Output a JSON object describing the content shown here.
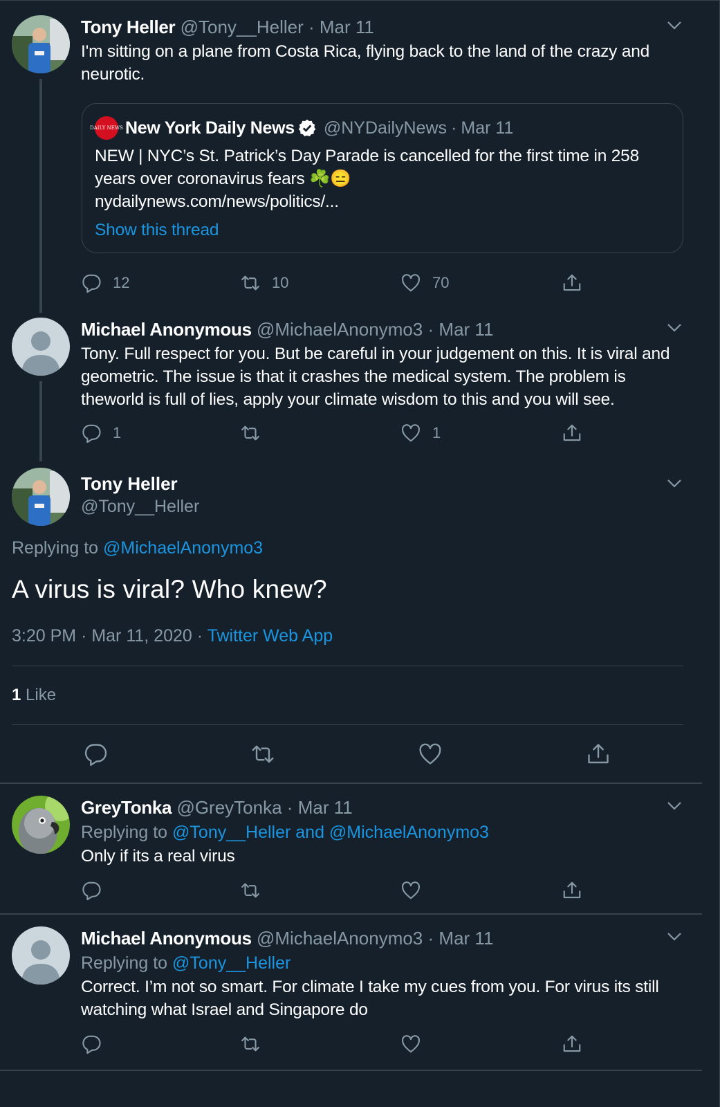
{
  "tweets": [
    {
      "name": "Tony Heller",
      "handle": "@Tony__Heller",
      "dot": "·",
      "date": "Mar 11",
      "text": "I'm sitting on a plane from Costa Rica, flying back to the land of the crazy and neurotic.",
      "quote": {
        "logo_text": "DAILY NEWS",
        "name": "New York Daily News",
        "handle": "@NYDailyNews",
        "dot": "·",
        "date": "Mar 11",
        "text": "NEW | NYC’s St. Patrick’s Day Parade is cancelled for the first time in 258 years over coronavirus fears ☘️😑",
        "url": "nydailynews.com/news/politics/...",
        "thread_link": "Show this thread"
      },
      "stats": {
        "replies": "12",
        "retweets": "10",
        "likes": "70"
      }
    },
    {
      "name": "Michael Anonymous",
      "handle": "@MichaelAnonymo3",
      "dot": "·",
      "date": "Mar 11",
      "text": "Tony. Full respect for you.  But be careful in your judgement on this. It is viral and geometric. The issue is that it crashes the medical system. The problem is theworld is full of lies, apply your climate wisdom to this and you will see.",
      "stats": {
        "replies": "1",
        "retweets": "",
        "likes": "1"
      }
    }
  ],
  "main_tweet": {
    "name": "Tony Heller",
    "handle": "@Tony__Heller",
    "replying_prefix": "Replying to ",
    "replying_to": "@MichaelAnonymo3",
    "text": "A virus is viral?  Who knew?",
    "time": "3:20 PM · Mar 11, 2020",
    "dot": "·",
    "source": "Twitter Web App",
    "likes_count": "1",
    "likes_label": " Like"
  },
  "replies": [
    {
      "name": "GreyTonka",
      "handle": "@GreyTonka",
      "dot": "·",
      "date": "Mar 11",
      "replying_prefix": "Replying to ",
      "replying_to": "@Tony__Heller and @MichaelAnonymo3",
      "text": "Only if its a real virus"
    },
    {
      "name": "Michael Anonymous",
      "handle": "@MichaelAnonymo3",
      "dot": "·",
      "date": "Mar 11",
      "replying_prefix": "Replying to ",
      "replying_to": "@Tony__Heller",
      "text": "Correct.  I’m not so smart. For climate I take my cues from you. For virus its still watching what Israel and Singapore do"
    }
  ],
  "colors": {
    "background": "#15202b",
    "border": "#38444d",
    "muted": "#8899a6",
    "link": "#1b95e0",
    "text": "#ffffff"
  }
}
